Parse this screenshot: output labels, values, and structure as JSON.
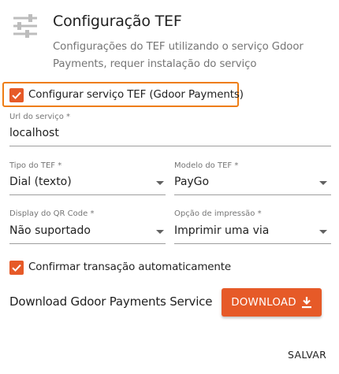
{
  "header": {
    "icon": "sliders-icon",
    "title": "Configuração TEF",
    "subtitle": "Configurações do TEF utilizando o serviço Gdoor Payments, requer instalação do serviço"
  },
  "enable_tef": {
    "checked": true,
    "label": "Configurar serviço TEF (Gdoor Payments)"
  },
  "url_field": {
    "label": "Url do serviço *",
    "value": "localhost"
  },
  "tipo_tef": {
    "label": "Tipo do TEF *",
    "value": "Dial (texto)"
  },
  "modelo_tef": {
    "label": "Modelo do TEF *",
    "value": "PayGo"
  },
  "display_qr": {
    "label": "Display do QR Code *",
    "value": "Não suportado"
  },
  "opcao_impressao": {
    "label": "Opção de impressão *",
    "value": "Imprimir uma via"
  },
  "auto_confirm": {
    "checked": true,
    "label": "Confirmar transação automaticamente"
  },
  "download": {
    "text": "Download Gdoor Payments Service",
    "button_label": "DOWNLOAD",
    "icon": "download-icon"
  },
  "save_label": "SALVAR",
  "colors": {
    "accent": "#e65a28",
    "highlight_border": "#ee7d14",
    "muted_text": "#757575"
  }
}
